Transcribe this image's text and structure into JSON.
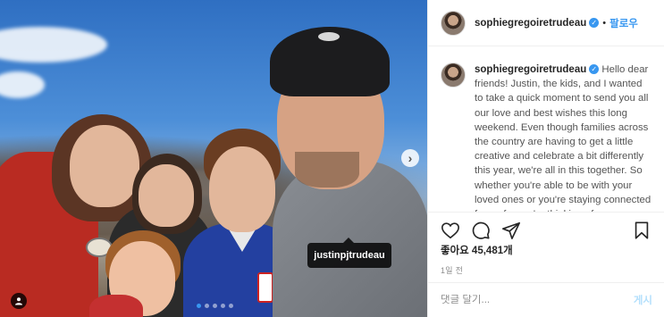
{
  "photo": {
    "tag_label": "justinpjtrudeau",
    "carousel_pages": 5,
    "carousel_active_index": 0
  },
  "post": {
    "username": "sophiegregoiretrudeau",
    "separator": "•",
    "follow_label": "팔로우",
    "caption": "Hello dear friends! Justin, the kids, and I wanted to take a quick moment to send you all our love and best wishes this long weekend. Even though families across the country are having to get a little creative and celebrate a bit differently this year, we're all in this together. So whether you're able to be with your loved ones or you're staying connected from afar, we're thinking of",
    "likes_text": "좋아요 45,481개",
    "time_ago": "1일 전",
    "comment_placeholder": "댓글 달기...",
    "post_label": "게시"
  },
  "icons": {
    "verified": "verified-badge-icon",
    "like": "heart-icon",
    "comment": "comment-icon",
    "share": "share-icon",
    "save": "bookmark-icon",
    "tag": "user-tag-icon",
    "next": "chevron-right-icon"
  },
  "colors": {
    "accent": "#3897f0",
    "post_disabled": "#b2dffc",
    "text": "#262626",
    "muted": "#8e8e8e"
  }
}
